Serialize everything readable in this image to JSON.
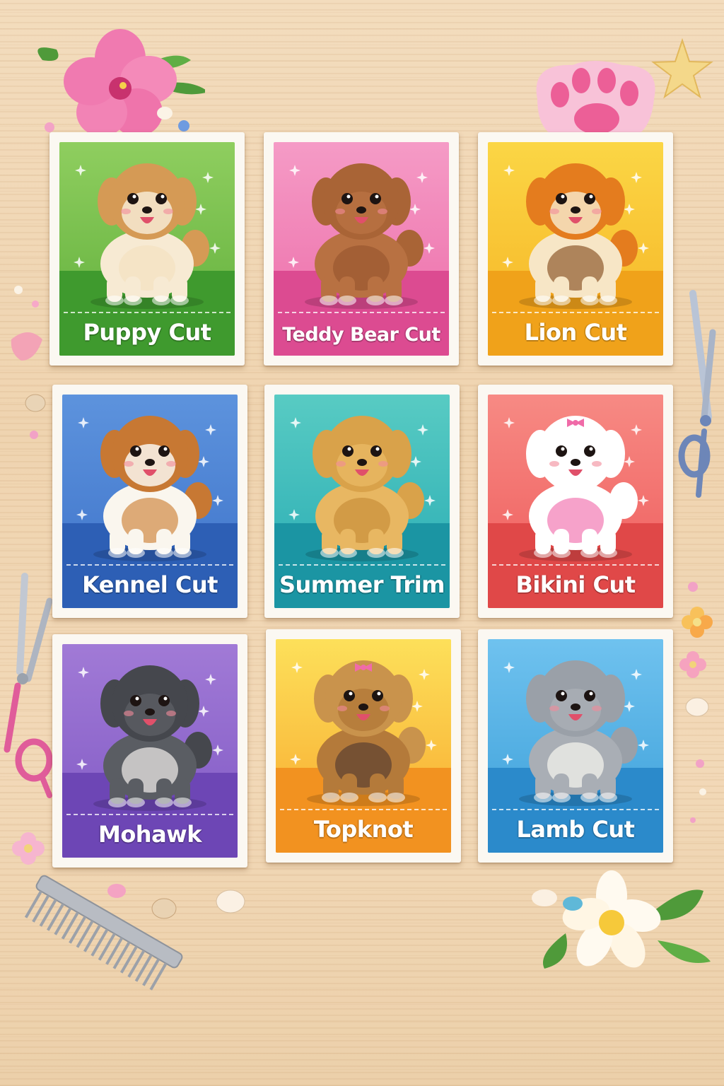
{
  "cards": [
    {
      "label": "Puppy Cut",
      "colors": {
        "top": "#8fce5f",
        "bottom": "#5fae3a",
        "floor": "#3f9a2e"
      },
      "dog": {
        "fur": "#d59a55",
        "body": "#f7ead3",
        "accent": "#f3e1c1",
        "bow": ""
      }
    },
    {
      "label": "Teddy Bear Cut",
      "colors": {
        "top": "#f59bc6",
        "bottom": "#ec6aa7",
        "floor": "#dc4b91"
      },
      "dog": {
        "fur": "#a96436",
        "body": "#b87142",
        "accent": "#9a5830",
        "bow": ""
      }
    },
    {
      "label": "Lion Cut",
      "colors": {
        "top": "#fbd645",
        "bottom": "#f6b324",
        "floor": "#f0a21a"
      },
      "dog": {
        "fur": "#e47c1e",
        "body": "#f7e6c6",
        "accent": "#8f5a2d",
        "bow": ""
      }
    },
    {
      "label": "Kennel Cut",
      "colors": {
        "top": "#5d93dd",
        "bottom": "#3d72c9",
        "floor": "#2d5fb5"
      },
      "dog": {
        "fur": "#c77833",
        "body": "#faf6ee",
        "accent": "#d08a45",
        "bow": ""
      }
    },
    {
      "label": "Summer Trim",
      "colors": {
        "top": "#58cbc3",
        "bottom": "#26aab3",
        "floor": "#1b95a3"
      },
      "dog": {
        "fur": "#d9a24a",
        "body": "#e8b762",
        "accent": "#c98e3a",
        "bow": ""
      }
    },
    {
      "label": "Bikini Cut",
      "colors": {
        "top": "#f78a84",
        "bottom": "#ee5a5a",
        "floor": "#e04848"
      },
      "dog": {
        "fur": "#ffffff",
        "body": "#ffffff",
        "accent": "#f27bb4",
        "bow": "#f06ba8"
      }
    },
    {
      "label": "Mohawk",
      "colors": {
        "top": "#a17ad6",
        "bottom": "#7f58c4",
        "floor": "#6d46b5"
      },
      "dog": {
        "fur": "#45474d",
        "body": "#5a5d63",
        "accent": "#f2f0ec",
        "bow": ""
      }
    },
    {
      "label": "Topknot",
      "colors": {
        "top": "#fde05a",
        "bottom": "#f7a62c",
        "floor": "#f29220"
      },
      "dog": {
        "fur": "#c9934c",
        "body": "#b47a3a",
        "accent": "#5b4030",
        "bow": "#f06ba8"
      }
    },
    {
      "label": "Lamb Cut",
      "colors": {
        "top": "#6fc2ef",
        "bottom": "#3a9ed8",
        "floor": "#2b8acb"
      },
      "dog": {
        "fur": "#9aa0a8",
        "body": "#a9aeb5",
        "accent": "#f8f6f0",
        "bow": ""
      }
    }
  ],
  "decorations": [
    {
      "name": "hibiscus-flower",
      "color": "#f07ab0"
    },
    {
      "name": "paw-soap",
      "color": "#f6a6c6"
    },
    {
      "name": "starfish",
      "color": "#f4d88a"
    },
    {
      "name": "grooming-scissors",
      "color": "#6d86b8"
    },
    {
      "name": "pink-scissors",
      "color": "#e05c9a"
    },
    {
      "name": "comb",
      "color": "#a9adb4"
    },
    {
      "name": "plumeria-flower",
      "color": "#fff6e0"
    }
  ]
}
